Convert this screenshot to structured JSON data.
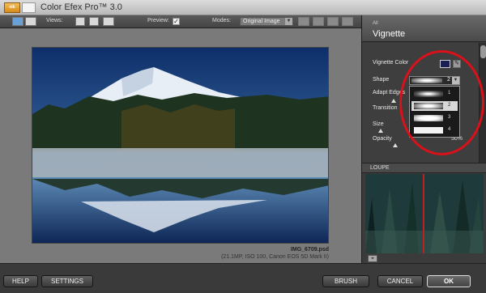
{
  "window": {
    "title": "Color Efex Pro™ 3.0",
    "app_icon_text": "nik"
  },
  "toolbar": {
    "views_label": "Views:",
    "preview_label": "Preview:",
    "preview_checked": "✓",
    "modes_label": "Modes:",
    "mode_value": "Original Image"
  },
  "image": {
    "filename": "IMG_6709.psd",
    "meta": "(21.1MP, ISO 100, Canon EOS 5D Mark II)"
  },
  "panel": {
    "breadcrumb": "All",
    "filter_name": "Vignette",
    "controls": {
      "vignette_color_label": "Vignette Color",
      "vignette_color": "#1a2050",
      "shape_label": "Shape",
      "shape_value": "2",
      "adapt_edges_label": "Adapt Edges",
      "transition_label": "Transition",
      "size_label": "Size",
      "opacity_label": "Opacity",
      "opacity_value": "50%"
    },
    "shape_options": [
      "1",
      "2",
      "3",
      "4"
    ],
    "shape_selected": "2",
    "loupe_title": "LOUPE"
  },
  "buttons": {
    "help": "HELP",
    "settings": "SETTINGS",
    "brush": "BRUSH",
    "cancel": "CANCEL",
    "ok": "OK"
  },
  "colors": {
    "annotation_circle": "#d8111a"
  }
}
